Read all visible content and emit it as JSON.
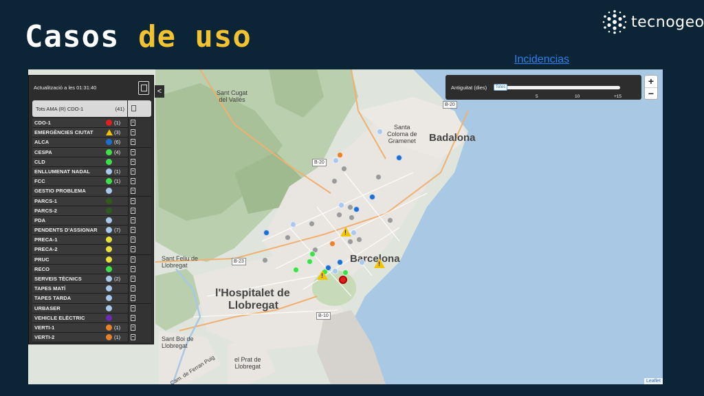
{
  "slide": {
    "title_white": "Casos",
    "title_yellow": "de uso",
    "link_text": "Incidencias",
    "logo_text": "tecnogeo"
  },
  "panel": {
    "updated": "Actualització a les 01:31:40",
    "collapse_glyph": "<",
    "all_label": "Tots AMA (R) CDO-1",
    "all_count": "(41)",
    "layers": [
      {
        "label": "CDO-1",
        "color": "#e02020",
        "count": "(1)"
      },
      {
        "label": "EMERGÈNCIES CIUTAT",
        "color": "#f2c400",
        "icon": "warning-icon",
        "count": "(3)"
      },
      {
        "label": "ALCA",
        "color": "#1f6fd1",
        "count": "(6)"
      },
      {
        "label": "CESPA",
        "color": "#3ee04a",
        "count": "(4)"
      },
      {
        "label": "CLD",
        "color": "#3ee04a",
        "count": ""
      },
      {
        "label": "ENLLUMENAT NADAL",
        "color": "#a9c8ea",
        "count": "(1)"
      },
      {
        "label": "FCC",
        "color": "#3ee04a",
        "count": "(1)"
      },
      {
        "label": "GESTIO PROBLEMA",
        "color": "#a9c8ea",
        "count": ""
      },
      {
        "label": "PARCS-1",
        "color": "#2e5a1e",
        "count": ""
      },
      {
        "label": "PARCS-2",
        "color": "#2e5a1e",
        "count": ""
      },
      {
        "label": "PDA",
        "color": "#a9c8ea",
        "count": ""
      },
      {
        "label": "PENDENTS D'ASSIGNAR",
        "color": "#a9c8ea",
        "count": "(7)"
      },
      {
        "label": "PRECA-1",
        "color": "#e6e23a",
        "count": ""
      },
      {
        "label": "PRECA-2",
        "color": "#e6e23a",
        "count": ""
      },
      {
        "label": "PRUC",
        "color": "#e6e23a",
        "count": ""
      },
      {
        "label": "RECO",
        "color": "#3ee04a",
        "count": ""
      },
      {
        "label": "SERVEIS TÈCNICS",
        "color": "#a9c8ea",
        "count": "(2)"
      },
      {
        "label": "TAPES MATÍ",
        "color": "#a9c8ea",
        "count": ""
      },
      {
        "label": "TAPES TARDA",
        "color": "#a9c8ea",
        "count": ""
      },
      {
        "label": "URBASER",
        "color": "#a9c8ea",
        "count": ""
      },
      {
        "label": "VEHICLE ELÈCTRIC",
        "color": "#6a2bb8",
        "count": ""
      },
      {
        "label": "VERTI-1",
        "color": "#e8822a",
        "count": "(1)"
      },
      {
        "label": "VERTI-2",
        "color": "#e8822a",
        "count": "(1)"
      }
    ]
  },
  "filter": {
    "label": "Antiguitat (dies)",
    "handle": "Totes",
    "ticks": [
      "5",
      "10",
      "+15"
    ]
  },
  "zoom": {
    "in": "+",
    "out": "−"
  },
  "attribution": "Leaflet",
  "map": {
    "places": {
      "sant_cugat": "Sant Cugat\ndel Vallès",
      "santa_coloma": "Santa\nColoma de\nGramenet",
      "badalona": "Badalona",
      "barcelona": "Barcelona",
      "hospitalet_1": "l'Hospitalet de",
      "hospitalet_2": "Llobregat",
      "sant_feliu": "Sant Feliu de\nLlobregat",
      "sant_boi": "Sant Boi de\nLlobregat",
      "el_prat": "el Prat de\nLlobregat",
      "cam_ferran": "Cam. de Ferran Puig"
    },
    "roads": [
      "B-20",
      "B-20",
      "B-23",
      "B-10"
    ]
  }
}
